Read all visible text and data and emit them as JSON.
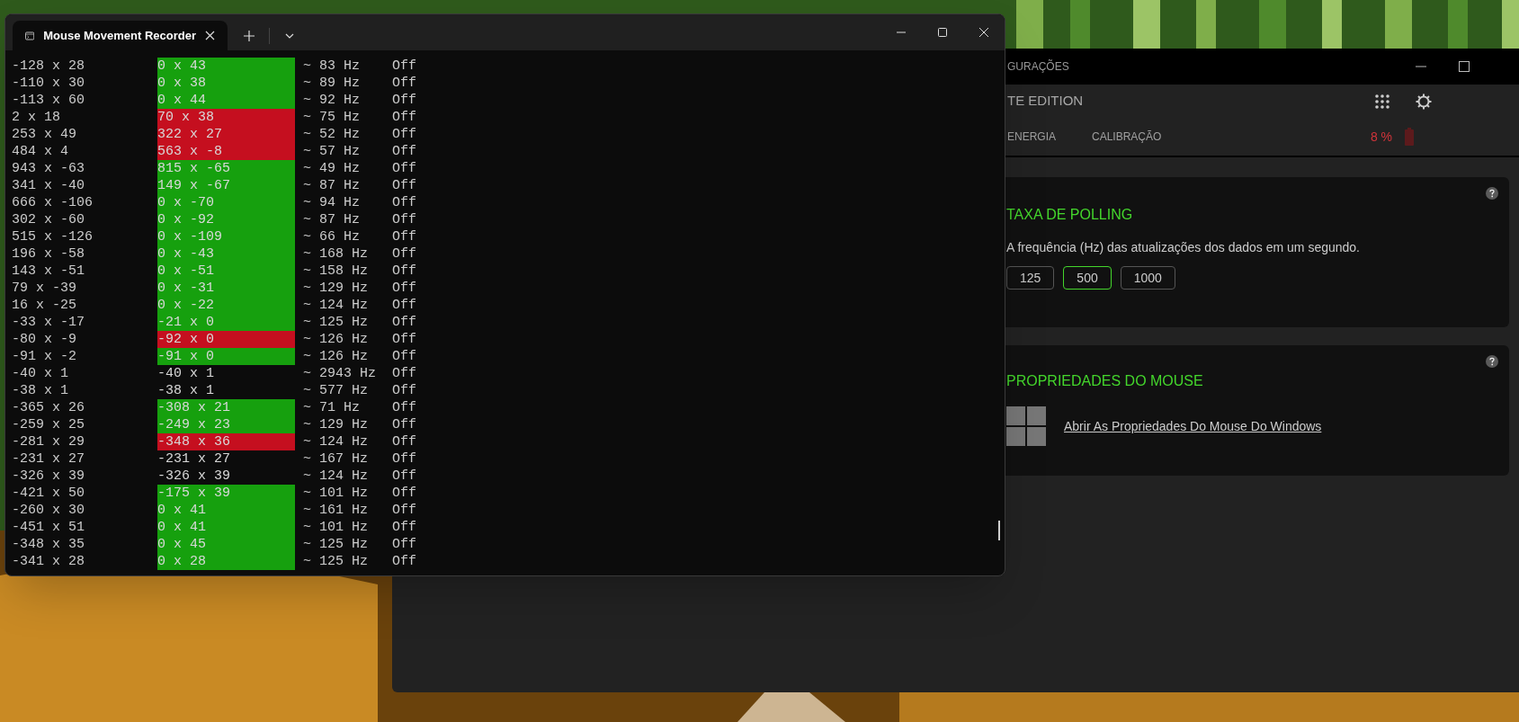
{
  "terminal": {
    "tab_title": "Mouse Movement Recorder",
    "rows": [
      {
        "c1": "-128 x 28",
        "c2": "0 x 43",
        "color": "#16a00e",
        "c3": "~ 83 Hz",
        "c4": "Off"
      },
      {
        "c1": "-110 x 30",
        "c2": "0 x 38",
        "color": "#16a00e",
        "c3": "~ 89 Hz",
        "c4": "Off"
      },
      {
        "c1": "-113 x 60",
        "c2": "0 x 44",
        "color": "#16a00e",
        "c3": "~ 92 Hz",
        "c4": "Off"
      },
      {
        "c1": "2 x 18",
        "c2": "70 x 38",
        "color": "#c50f1f",
        "c3": "~ 75 Hz",
        "c4": "Off"
      },
      {
        "c1": "253 x 49",
        "c2": "322 x 27",
        "color": "#c50f1f",
        "c3": "~ 52 Hz",
        "c4": "Off"
      },
      {
        "c1": "484 x 4",
        "c2": "563 x -8",
        "color": "#c50f1f",
        "c3": "~ 57 Hz",
        "c4": "Off"
      },
      {
        "c1": "943 x -63",
        "c2": "815 x -65",
        "color": "#16a00e",
        "c3": "~ 49 Hz",
        "c4": "Off"
      },
      {
        "c1": "341 x -40",
        "c2": "149 x -67",
        "color": "#16a00e",
        "c3": "~ 87 Hz",
        "c4": "Off"
      },
      {
        "c1": "666 x -106",
        "c2": "0 x -70",
        "color": "#16a00e",
        "c3": "~ 94 Hz",
        "c4": "Off"
      },
      {
        "c1": "302 x -60",
        "c2": "0 x -92",
        "color": "#16a00e",
        "c3": "~ 87 Hz",
        "c4": "Off"
      },
      {
        "c1": "515 x -126",
        "c2": "0 x -109",
        "color": "#16a00e",
        "c3": "~ 66 Hz",
        "c4": "Off"
      },
      {
        "c1": "196 x -58",
        "c2": "0 x -43",
        "color": "#16a00e",
        "c3": "~ 168 Hz",
        "c4": "Off"
      },
      {
        "c1": "143 x -51",
        "c2": "0 x -51",
        "color": "#16a00e",
        "c3": "~ 158 Hz",
        "c4": "Off"
      },
      {
        "c1": "79 x -39",
        "c2": "0 x -31",
        "color": "#16a00e",
        "c3": "~ 129 Hz",
        "c4": "Off"
      },
      {
        "c1": "16 x -25",
        "c2": "0 x -22",
        "color": "#16a00e",
        "c3": "~ 124 Hz",
        "c4": "Off"
      },
      {
        "c1": "-33 x -17",
        "c2": "-21 x 0",
        "color": "#16a00e",
        "c3": "~ 125 Hz",
        "c4": "Off"
      },
      {
        "c1": "-80 x -9",
        "c2": "-92 x 0",
        "color": "#c50f1f",
        "c3": "~ 126 Hz",
        "c4": "Off"
      },
      {
        "c1": "-91 x -2",
        "c2": "-91 x 0",
        "color": "#16a00e",
        "c3": "~ 126 Hz",
        "c4": "Off"
      },
      {
        "c1": "-40 x 1",
        "c2": "-40 x 1",
        "c3": "~ 2943 Hz",
        "c4": "Off"
      },
      {
        "c1": "-38 x 1",
        "c2": "-38 x 1",
        "c3": "~ 577 Hz",
        "c4": "Off"
      },
      {
        "c1": "-365 x 26",
        "c2": "-308 x 21",
        "color": "#16a00e",
        "c3": "~ 71 Hz",
        "c4": "Off"
      },
      {
        "c1": "-259 x 25",
        "c2": "-249 x 23",
        "color": "#16a00e",
        "c3": "~ 129 Hz",
        "c4": "Off"
      },
      {
        "c1": "-281 x 29",
        "c2": "-348 x 36",
        "color": "#c50f1f",
        "c3": "~ 124 Hz",
        "c4": "Off"
      },
      {
        "c1": "-231 x 27",
        "c2": "-231 x 27",
        "c3": "~ 167 Hz",
        "c4": "Off"
      },
      {
        "c1": "-326 x 39",
        "c2": "-326 x 39",
        "c3": "~ 124 Hz",
        "c4": "Off"
      },
      {
        "c1": "-421 x 50",
        "c2": "-175 x 39",
        "color": "#16a00e",
        "c3": "~ 101 Hz",
        "c4": "Off"
      },
      {
        "c1": "-260 x 30",
        "c2": "0 x 41",
        "color": "#16a00e",
        "c3": "~ 161 Hz",
        "c4": "Off"
      },
      {
        "c1": "-451 x 51",
        "c2": "0 x 41",
        "color": "#16a00e",
        "c3": "~ 101 Hz",
        "c4": "Off"
      },
      {
        "c1": "-348 x 35",
        "c2": "0 x 45",
        "color": "#16a00e",
        "c3": "~ 125 Hz",
        "c4": "Off"
      },
      {
        "c1": "-341 x 28",
        "c2": "0 x 28",
        "color": "#16a00e",
        "c3": "~ 125 Hz",
        "c4": "Off"
      }
    ]
  },
  "settings_window": {
    "title": "GURAÇÕES",
    "product": "TE EDITION",
    "tabs": [
      {
        "label": "ENERGIA",
        "selected": false
      },
      {
        "label": "CALIBRAÇÃO",
        "selected": false
      }
    ],
    "battery": "8 %",
    "polling": {
      "title": "TAXA DE POLLING",
      "description": "A frequência (Hz) das atualizações dos dados em um segundo.",
      "options": [
        {
          "label": "125",
          "selected": false
        },
        {
          "label": "500",
          "selected": true
        },
        {
          "label": "1000",
          "selected": false
        }
      ]
    },
    "mouse_properties": {
      "title": "PROPRIEDADES DO MOUSE",
      "link": "Abrir As Propriedades Do Mouse Do Windows"
    }
  }
}
